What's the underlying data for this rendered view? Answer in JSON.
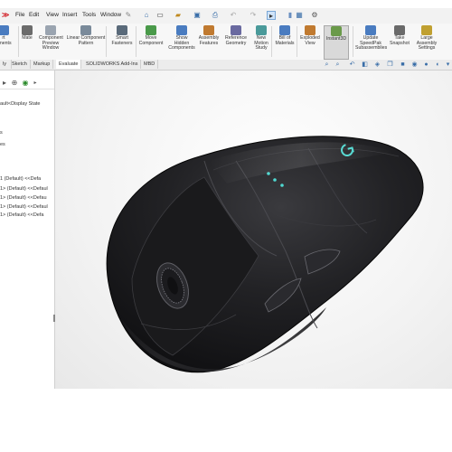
{
  "menu": {
    "items": [
      "File",
      "Edit",
      "View",
      "Insert",
      "Tools",
      "Window"
    ]
  },
  "ribbon": {
    "commands": [
      {
        "label": "rt\nonents",
        "icon": "insert-components-icon",
        "color": "#4a7cc0"
      },
      {
        "label": "Mate",
        "icon": "mate-icon",
        "color": "#6b6b6b"
      },
      {
        "label": "Component\nPreview\nWindow",
        "icon": "preview-window-icon",
        "color": "#9aa4b0"
      },
      {
        "label": "Linear Component\nPattern",
        "icon": "linear-pattern-icon",
        "color": "#7a8a9a"
      },
      {
        "label": "Smart\nFasteners",
        "icon": "smart-fasteners-icon",
        "color": "#5a6a7a"
      },
      {
        "label": "Move\nComponent",
        "icon": "move-component-icon",
        "color": "#4a9a4a"
      },
      {
        "label": "Show\nHidden\nComponents",
        "icon": "show-hidden-icon",
        "color": "#4a7cc0"
      },
      {
        "label": "Assembly\nFeatures",
        "icon": "assembly-features-icon",
        "color": "#c07a30"
      },
      {
        "label": "Reference\nGeometry",
        "icon": "reference-geometry-icon",
        "color": "#6a6aa0"
      },
      {
        "label": "New\nMotion\nStudy",
        "icon": "motion-study-icon",
        "color": "#4a9a9a"
      },
      {
        "label": "Bill of\nMaterials",
        "icon": "bill-of-materials-icon",
        "color": "#4a7cc0"
      },
      {
        "label": "Exploded\nView",
        "icon": "exploded-view-icon",
        "color": "#c07a30"
      },
      {
        "label": "Instant3D",
        "icon": "instant3d-icon",
        "color": "#6a9a4a"
      },
      {
        "label": "Update\nSpeedPak\nSubassemblies",
        "icon": "speedpak-icon",
        "color": "#4a7cc0"
      },
      {
        "label": "Take\nSnapshot",
        "icon": "snapshot-icon",
        "color": "#6a6a6a"
      },
      {
        "label": "Large\nAssembly\nSettings",
        "icon": "large-assembly-icon",
        "color": "#c0a030"
      }
    ]
  },
  "tabs": [
    "ly",
    "Sketch",
    "Markup",
    "Evaluate",
    "SOLIDWORKS Add-Ins",
    "MBD"
  ],
  "tree": {
    "line1": "ault<Display State",
    "line2": "s",
    "line3": "es",
    "line4": "1 (Default) <<Defa",
    "line5": "1> (Default) <<Defaul",
    "line6": "1> (Default) <<Defau",
    "line7": "1> (Default) <<Defaul",
    "line8": "1> (Default) <<Defa"
  },
  "colors": {
    "accent": "#3a7fd5",
    "body": "#1e1e20",
    "led": "#4fd8d0"
  }
}
